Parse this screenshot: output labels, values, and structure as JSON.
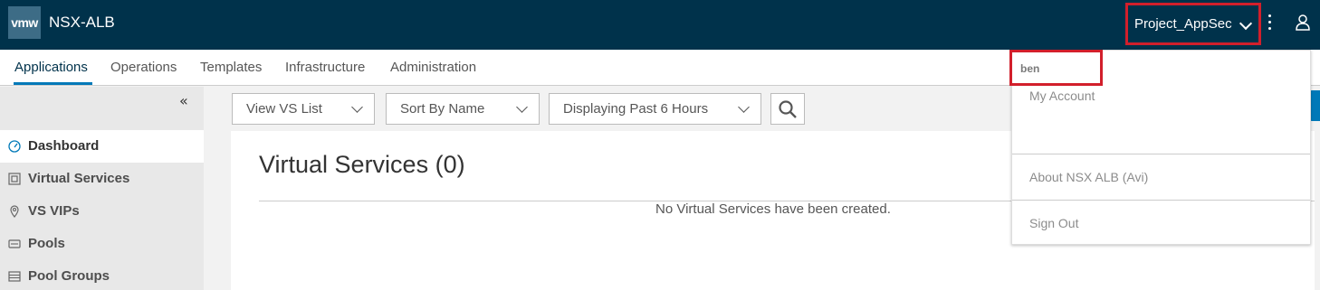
{
  "header": {
    "logo": "vmw",
    "app_name": "NSX-ALB",
    "tenant": "Project_AppSec"
  },
  "nav": {
    "tabs": [
      {
        "label": "Applications",
        "active": true
      },
      {
        "label": "Operations"
      },
      {
        "label": "Templates"
      },
      {
        "label": "Infrastructure"
      },
      {
        "label": "Administration"
      }
    ]
  },
  "sidebar": {
    "collapse_glyph": "«",
    "items": [
      {
        "label": "Dashboard",
        "icon": "dashboard-icon",
        "active": true
      },
      {
        "label": "Virtual Services",
        "icon": "virtual-services-icon"
      },
      {
        "label": "VS VIPs",
        "icon": "location-pin-icon"
      },
      {
        "label": "Pools",
        "icon": "pools-icon"
      },
      {
        "label": "Pool Groups",
        "icon": "pool-groups-icon"
      }
    ]
  },
  "toolbar": {
    "view_select": "View VS List",
    "sort_select": "Sort By Name",
    "time_select": "Displaying Past 6 Hours"
  },
  "main": {
    "title": "Virtual Services (0)",
    "empty_message": "No Virtual Services have been created."
  },
  "user_menu": {
    "username": "ben",
    "my_account": "My Account",
    "about": "About NSX ALB (Avi)",
    "sign_out": "Sign Out"
  },
  "colors": {
    "header_bg": "#00324b",
    "accent": "#0079b8",
    "highlight": "#d21f2b"
  }
}
